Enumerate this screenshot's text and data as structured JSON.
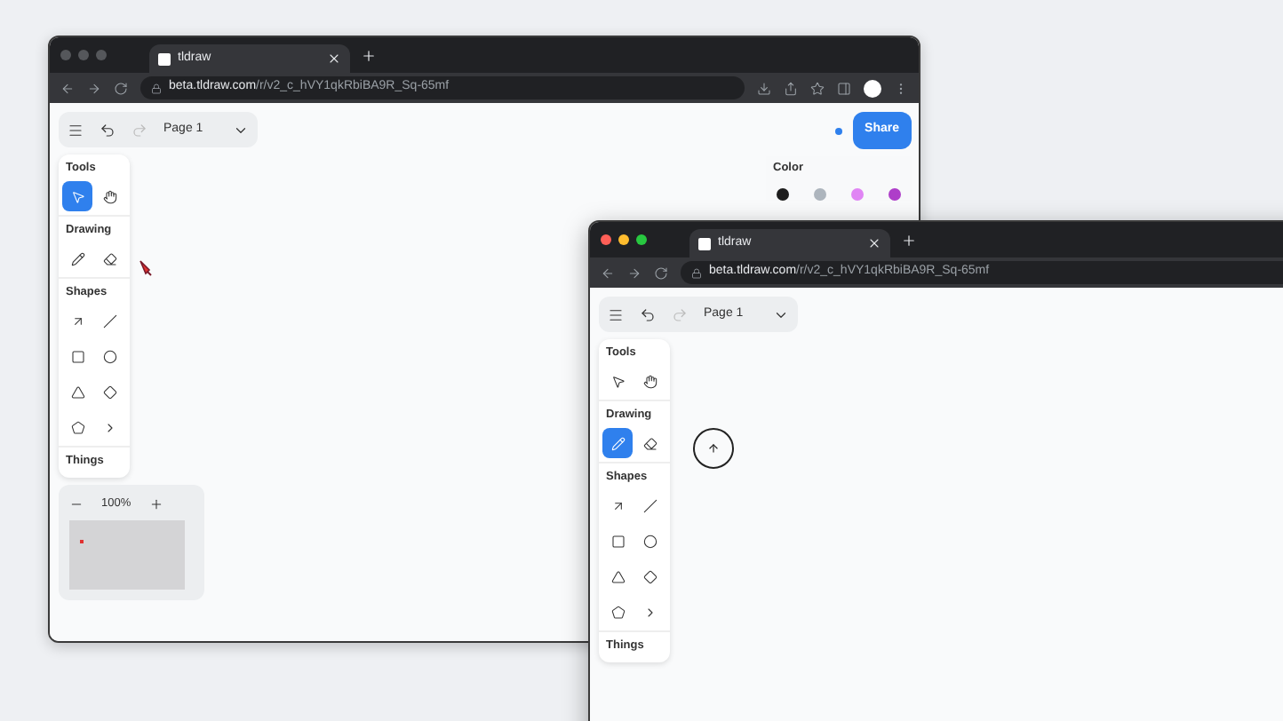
{
  "windows": [
    {
      "focused": false,
      "tab": {
        "title": "tldraw"
      },
      "address": {
        "host": "beta.tldraw.com",
        "path": "/r/v2_c_hVY1qkRbiBA9R_Sq-65mf"
      },
      "menu": {
        "page": "Page 1"
      },
      "share": {
        "label": "Share"
      },
      "tool_groups": [
        {
          "title": "Tools",
          "tools": [
            {
              "kind": "select",
              "selected": true
            },
            {
              "kind": "hand",
              "selected": false
            }
          ]
        },
        {
          "title": "Drawing",
          "tools": [
            {
              "kind": "draw",
              "selected": false
            },
            {
              "kind": "eraser",
              "selected": false
            }
          ]
        },
        {
          "title": "Shapes",
          "tools": [
            {
              "kind": "arrow",
              "selected": false
            },
            {
              "kind": "line",
              "selected": false
            },
            {
              "kind": "rectangle",
              "selected": false
            },
            {
              "kind": "ellipse",
              "selected": false
            },
            {
              "kind": "triangle",
              "selected": false
            },
            {
              "kind": "diamond",
              "selected": false
            },
            {
              "kind": "pentagon",
              "selected": false
            },
            {
              "kind": "more",
              "selected": false
            }
          ]
        },
        {
          "title": "Things"
        }
      ],
      "color_panel": {
        "title": "Color",
        "swatches": [
          {
            "color": "#1d1d1d"
          },
          {
            "color": "#adb5bd"
          },
          {
            "color": "#e085f4"
          },
          {
            "color": "#ae3ec9"
          }
        ]
      },
      "zoom": {
        "value": "100%"
      },
      "cursor": {
        "kind": "laser"
      }
    },
    {
      "focused": true,
      "tab": {
        "title": "tldraw"
      },
      "address": {
        "host": "beta.tldraw.com",
        "path": "/r/v2_c_hVY1qkRbiBA9R_Sq-65mf"
      },
      "menu": {
        "page": "Page 1"
      },
      "tool_groups": [
        {
          "title": "Tools",
          "tools": [
            {
              "kind": "select",
              "selected": false
            },
            {
              "kind": "hand",
              "selected": false
            }
          ]
        },
        {
          "title": "Drawing",
          "tools": [
            {
              "kind": "draw",
              "selected": true
            },
            {
              "kind": "eraser",
              "selected": false
            }
          ]
        },
        {
          "title": "Shapes",
          "tools": [
            {
              "kind": "arrow",
              "selected": false
            },
            {
              "kind": "line",
              "selected": false
            },
            {
              "kind": "rectangle",
              "selected": false
            },
            {
              "kind": "ellipse",
              "selected": false
            },
            {
              "kind": "triangle",
              "selected": false
            },
            {
              "kind": "diamond",
              "selected": false
            },
            {
              "kind": "pentagon",
              "selected": false
            },
            {
              "kind": "more",
              "selected": false
            }
          ]
        },
        {
          "title": "Things"
        }
      ],
      "cursor": {
        "kind": "circle"
      }
    }
  ]
}
